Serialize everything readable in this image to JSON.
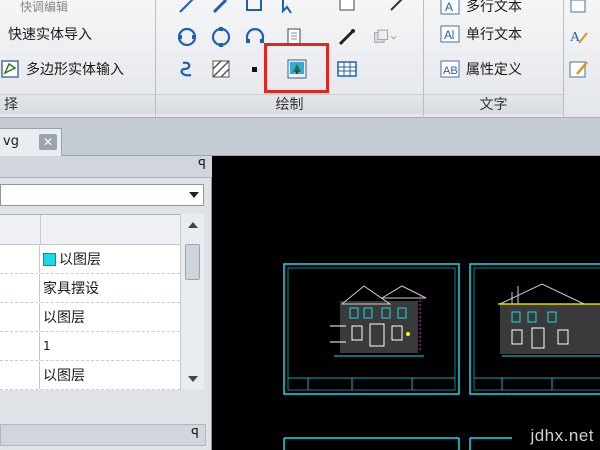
{
  "ribbon": {
    "group1": {
      "top_faded": "快调编辑",
      "items": [
        "快速实体导入",
        "多边形实体输入"
      ],
      "label": "择"
    },
    "group2": {
      "label": "绘制"
    },
    "group3": {
      "items": [
        "多行文本",
        "单行文本",
        "属性定义"
      ],
      "label": "文字"
    }
  },
  "tabs": {
    "doc_name": "vg",
    "close_label": "✕"
  },
  "properties": {
    "pin_label": "ꟼ",
    "rows": [
      {
        "value": "以图层",
        "has_swatch": true
      },
      {
        "value": "家具摆设"
      },
      {
        "value": "以图层"
      },
      {
        "value": "1"
      },
      {
        "value": "以图层"
      }
    ],
    "swatch_color": "#19d9e8"
  },
  "canvas": {
    "background": "#000000",
    "frame_color": "#19d9e8",
    "watermark": "jdhx.net"
  },
  "accent": {
    "highlight": "#e0261f"
  }
}
